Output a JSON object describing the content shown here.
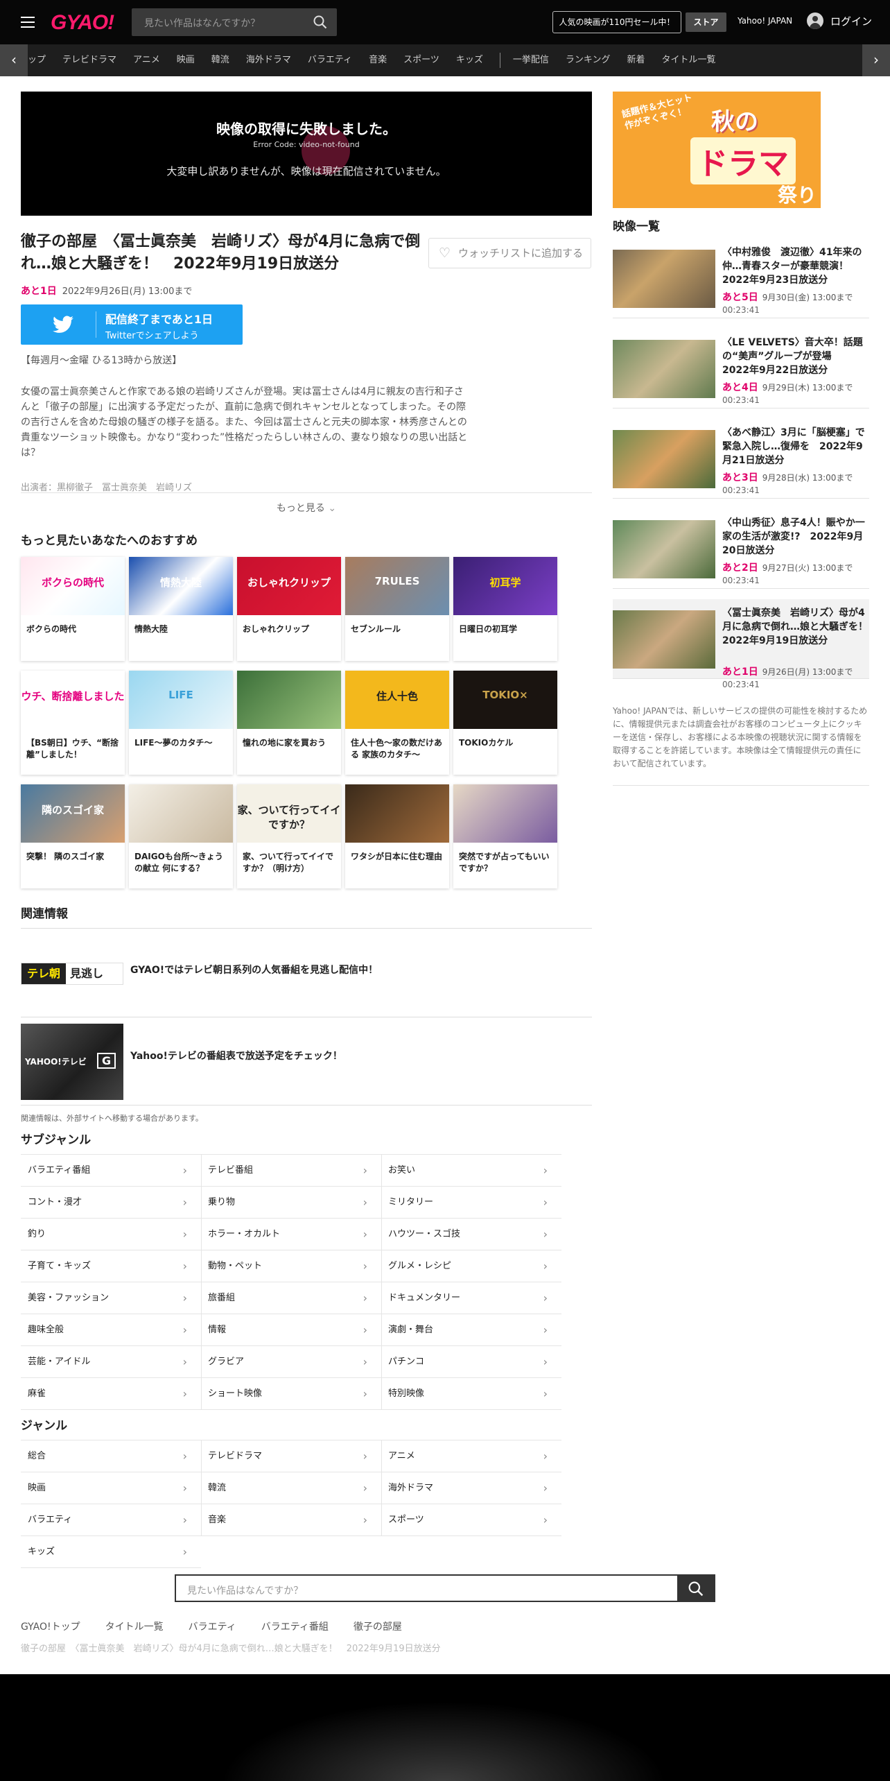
{
  "header": {
    "logo": "GYAO!",
    "search_placeholder": "見たい作品はなんですか？",
    "promo": "人気の映画が110円セール中！",
    "store": "ストア",
    "yahoo_japan": "Yahoo! JAPAN",
    "login": "ログイン"
  },
  "nav": {
    "items": [
      "ップ",
      "テレビドラマ",
      "アニメ",
      "映画",
      "韓流",
      "海外ドラマ",
      "バラエティ",
      "音楽",
      "スポーツ",
      "キッズ",
      "一挙配信",
      "ランキング",
      "新着",
      "タイトル一覧"
    ]
  },
  "player": {
    "error_title": "映像の取得に失敗しました。",
    "error_code": "Error Code: video-not-found",
    "error_message": "大変申し訳ありませんが、映像は現在配信されていません。"
  },
  "episode": {
    "title": "徹子の部屋　〈冨士眞奈美　岩崎リズ〉母が4月に急病で倒れ…娘と大騒ぎを！　2022年9月19日放送分",
    "watchlist": "ウォッチリストに追加する",
    "remaining": "あと1日",
    "deadline": "2022年9月26日(月) 13:00まで",
    "twitter_line1": "配信終了まであと1日",
    "twitter_line2": "Twitterでシェアしよう",
    "schedule": "【毎週月～金曜 ひる13時から放送】",
    "description": "女優の冨士眞奈美さんと作家である娘の岩崎リズさんが登場。実は冨士さんは4月に親友の吉行和子さんと「徹子の部屋」に出演する予定だったが、直前に急病で倒れキャンセルとなってしまった。その際の吉行さんを含めた母娘の騒ぎの様子を語る。また、今回は冨士さんと元夫の脚本家・林秀彦さんとの貴重なツーショット映像も。かなり“変わった”性格だったらしい林さんの、妻なり娘なりの思い出話とは？",
    "cast": "出演者：黒柳徹子　冨士眞奈美　岩崎リズ",
    "more": "もっと見る"
  },
  "recommend": {
    "heading": "もっと見たいあなたへのおすすめ",
    "items": [
      {
        "title": "ボクらの時代",
        "thumb": "ボクらの時代"
      },
      {
        "title": "情熱大陸",
        "thumb": "情熱大陸"
      },
      {
        "title": "おしゃれクリップ",
        "thumb": "おしゃれクリップ"
      },
      {
        "title": "セブンルール",
        "thumb": "7RULES"
      },
      {
        "title": "日曜日の初耳学",
        "thumb": "初耳学"
      },
      {
        "title": "【BS朝日】ウチ、“断捨離”しました！",
        "thumb": "ウチ、断捨離しました"
      },
      {
        "title": "LIFE～夢のカタチ～",
        "thumb": "LIFE"
      },
      {
        "title": "憧れの地に家を買おう",
        "thumb": ""
      },
      {
        "title": "住人十色～家の数だけある 家族のカタチ～",
        "thumb": "住人十色"
      },
      {
        "title": "TOKIOカケル",
        "thumb": "TOKIO×"
      },
      {
        "title": "突撃！ 隣のスゴイ家",
        "thumb": "隣のスゴイ家"
      },
      {
        "title": "DAIGOも台所～きょうの献立 何にする？",
        "thumb": ""
      },
      {
        "title": "家、ついて行ってイイですか？（明け方）",
        "thumb": "家、ついて行ってイイですか？"
      },
      {
        "title": "ワタシが日本に住む理由",
        "thumb": ""
      },
      {
        "title": "突然ですが占ってもいいですか？",
        "thumb": ""
      }
    ]
  },
  "related": {
    "heading": "関連情報",
    "items": [
      {
        "title": "GYAO!ではテレビ朝日系列の人気番組を見逃し配信中！",
        "logo": "テレ朝",
        "logo2": "見逃し"
      },
      {
        "title": "Yahoo!テレビの番組表で放送予定をチェック！",
        "logo": "YAHOO!テレビ",
        "logo2": "G"
      }
    ],
    "note": "関連情報は、外部サイトへ移動する場合があります。"
  },
  "subgenre": {
    "heading": "サブジャンル",
    "items": [
      "バラエティ番組",
      "テレビ番組",
      "お笑い",
      "コント・漫才",
      "乗り物",
      "ミリタリー",
      "釣り",
      "ホラー・オカルト",
      "ハウツー・スゴ技",
      "子育て・キッズ",
      "動物・ペット",
      "グルメ・レシピ",
      "美容・ファッション",
      "旅番組",
      "ドキュメンタリー",
      "趣味全般",
      "情報",
      "演劇・舞台",
      "芸能・アイドル",
      "グラビア",
      "パチンコ",
      "麻雀",
      "ショート映像",
      "特別映像"
    ]
  },
  "genre": {
    "heading": "ジャンル",
    "items": [
      "総合",
      "テレビドラマ",
      "アニメ",
      "映画",
      "韓流",
      "海外ドラマ",
      "バラエティ",
      "音楽",
      "スポーツ",
      "キッズ"
    ]
  },
  "bottom_search_placeholder": "見たい作品はなんですか？",
  "breadcrumb": [
    "GYAO!トップ",
    "タイトル一覧",
    "バラエティ",
    "バラエティ番組",
    "徹子の部屋"
  ],
  "breadcrumb_current": "徹子の部屋　〈冨士眞奈美　岩崎リズ〉母が4月に急病で倒れ…娘と大騒ぎを！　2022年9月19日放送分",
  "banner": {
    "line1": "話題作＆大ヒット作がぞくぞく！",
    "line2": "秋の",
    "line3": "ドラマ",
    "line4": "祭り"
  },
  "video_list": {
    "heading": "映像一覧",
    "items": [
      {
        "title": "〈中村雅俊　渡辺徹〉41年来の仲…青春スターが豪華競演！　2022年9月23日放送分",
        "remaining": "あと5日",
        "deadline": "9月30日(金) 13:00まで",
        "duration": "00:23:41"
      },
      {
        "title": "〈LE VELVETS〉音大卒！話題の“美声”グループが登場　2022年9月22日放送分",
        "remaining": "あと4日",
        "deadline": "9月29日(木) 13:00まで",
        "duration": "00:23:41"
      },
      {
        "title": "〈あべ静江〉3月に「脳梗塞」で緊急入院し…復帰を　2022年9月21日放送分",
        "remaining": "あと3日",
        "deadline": "9月28日(水) 13:00まで",
        "duration": "00:23:41"
      },
      {
        "title": "〈中山秀征〉息子4人！賑やか一家の生活が激変!?　2022年9月20日放送分",
        "remaining": "あと2日",
        "deadline": "9月27日(火) 13:00まで",
        "duration": "00:23:41"
      },
      {
        "title": "〈冨士眞奈美　岩崎リズ〉母が4月に急病で倒れ…娘と大騒ぎを！　2022年9月19日放送分",
        "remaining": "あと1日",
        "deadline": "9月26日(月) 13:00まで",
        "duration": "00:23:41"
      }
    ],
    "note": "Yahoo! JAPANでは、新しいサービスの提供の可能性を検討するために、情報提供元または調査会社がお客様のコンピュータ上にクッキーを送信・保存し、お客様による本映像の視聴状況に関する情報を取得することを許諾しています。本映像は全て情報提供元の責任において配信されています。"
  }
}
